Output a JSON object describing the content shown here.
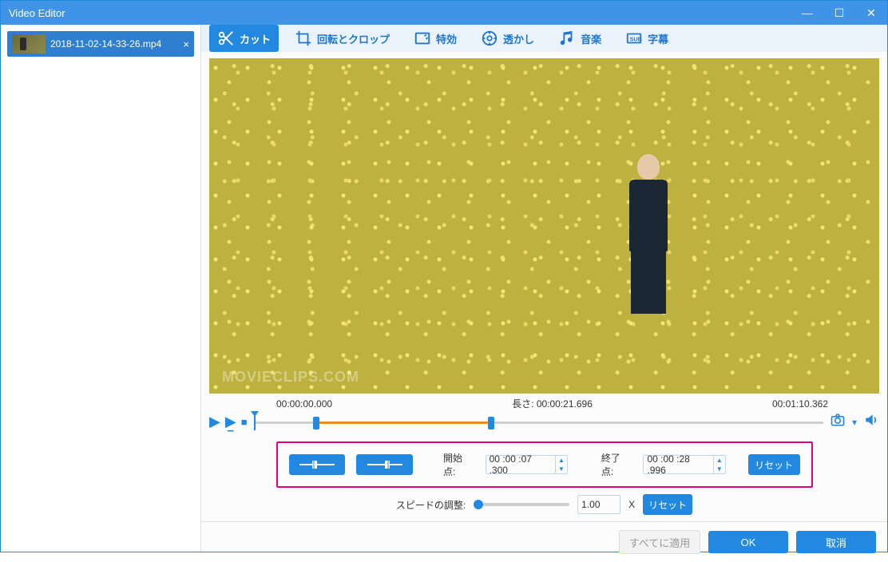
{
  "window": {
    "title": "Video Editor"
  },
  "file": {
    "name": "2018-11-02-14-33-26.mp4",
    "close": "×"
  },
  "tools": {
    "cut": "カット",
    "crop": "回転とクロップ",
    "effect": "特効",
    "watermark": "透かし",
    "music": "音楽",
    "subtitle": "字幕"
  },
  "preview": {
    "watermark": "MOVIECLIPS.COM"
  },
  "time": {
    "current": "00:00:00.000",
    "length_label": "長さ:",
    "length": "00:00:21.696",
    "total": "00:01:10.362"
  },
  "cut": {
    "start_label": "開始点:",
    "start_value": "00 :00 :07 .300",
    "end_label": "終了点:",
    "end_value": "00 :00 :28 .996",
    "reset": "リセット"
  },
  "speed": {
    "label": "スピードの調整:",
    "value": "1.00",
    "unit": "X",
    "reset": "リセット"
  },
  "footer": {
    "apply_all": "すべてに適用",
    "ok": "OK",
    "cancel": "取消"
  }
}
